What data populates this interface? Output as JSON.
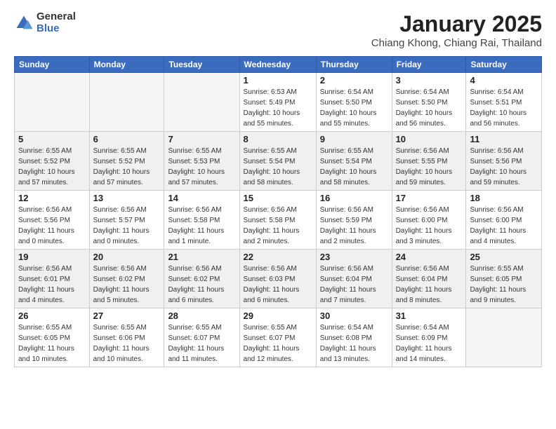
{
  "logo": {
    "general": "General",
    "blue": "Blue"
  },
  "title": "January 2025",
  "subtitle": "Chiang Khong, Chiang Rai, Thailand",
  "days_of_week": [
    "Sunday",
    "Monday",
    "Tuesday",
    "Wednesday",
    "Thursday",
    "Friday",
    "Saturday"
  ],
  "weeks": [
    [
      {
        "day": "",
        "info": ""
      },
      {
        "day": "",
        "info": ""
      },
      {
        "day": "",
        "info": ""
      },
      {
        "day": "1",
        "info": "Sunrise: 6:53 AM\nSunset: 5:49 PM\nDaylight: 10 hours\nand 55 minutes."
      },
      {
        "day": "2",
        "info": "Sunrise: 6:54 AM\nSunset: 5:50 PM\nDaylight: 10 hours\nand 55 minutes."
      },
      {
        "day": "3",
        "info": "Sunrise: 6:54 AM\nSunset: 5:50 PM\nDaylight: 10 hours\nand 56 minutes."
      },
      {
        "day": "4",
        "info": "Sunrise: 6:54 AM\nSunset: 5:51 PM\nDaylight: 10 hours\nand 56 minutes."
      }
    ],
    [
      {
        "day": "5",
        "info": "Sunrise: 6:55 AM\nSunset: 5:52 PM\nDaylight: 10 hours\nand 57 minutes."
      },
      {
        "day": "6",
        "info": "Sunrise: 6:55 AM\nSunset: 5:52 PM\nDaylight: 10 hours\nand 57 minutes."
      },
      {
        "day": "7",
        "info": "Sunrise: 6:55 AM\nSunset: 5:53 PM\nDaylight: 10 hours\nand 57 minutes."
      },
      {
        "day": "8",
        "info": "Sunrise: 6:55 AM\nSunset: 5:54 PM\nDaylight: 10 hours\nand 58 minutes."
      },
      {
        "day": "9",
        "info": "Sunrise: 6:55 AM\nSunset: 5:54 PM\nDaylight: 10 hours\nand 58 minutes."
      },
      {
        "day": "10",
        "info": "Sunrise: 6:56 AM\nSunset: 5:55 PM\nDaylight: 10 hours\nand 59 minutes."
      },
      {
        "day": "11",
        "info": "Sunrise: 6:56 AM\nSunset: 5:56 PM\nDaylight: 10 hours\nand 59 minutes."
      }
    ],
    [
      {
        "day": "12",
        "info": "Sunrise: 6:56 AM\nSunset: 5:56 PM\nDaylight: 11 hours\nand 0 minutes."
      },
      {
        "day": "13",
        "info": "Sunrise: 6:56 AM\nSunset: 5:57 PM\nDaylight: 11 hours\nand 0 minutes."
      },
      {
        "day": "14",
        "info": "Sunrise: 6:56 AM\nSunset: 5:58 PM\nDaylight: 11 hours\nand 1 minute."
      },
      {
        "day": "15",
        "info": "Sunrise: 6:56 AM\nSunset: 5:58 PM\nDaylight: 11 hours\nand 2 minutes."
      },
      {
        "day": "16",
        "info": "Sunrise: 6:56 AM\nSunset: 5:59 PM\nDaylight: 11 hours\nand 2 minutes."
      },
      {
        "day": "17",
        "info": "Sunrise: 6:56 AM\nSunset: 6:00 PM\nDaylight: 11 hours\nand 3 minutes."
      },
      {
        "day": "18",
        "info": "Sunrise: 6:56 AM\nSunset: 6:00 PM\nDaylight: 11 hours\nand 4 minutes."
      }
    ],
    [
      {
        "day": "19",
        "info": "Sunrise: 6:56 AM\nSunset: 6:01 PM\nDaylight: 11 hours\nand 4 minutes."
      },
      {
        "day": "20",
        "info": "Sunrise: 6:56 AM\nSunset: 6:02 PM\nDaylight: 11 hours\nand 5 minutes."
      },
      {
        "day": "21",
        "info": "Sunrise: 6:56 AM\nSunset: 6:02 PM\nDaylight: 11 hours\nand 6 minutes."
      },
      {
        "day": "22",
        "info": "Sunrise: 6:56 AM\nSunset: 6:03 PM\nDaylight: 11 hours\nand 6 minutes."
      },
      {
        "day": "23",
        "info": "Sunrise: 6:56 AM\nSunset: 6:04 PM\nDaylight: 11 hours\nand 7 minutes."
      },
      {
        "day": "24",
        "info": "Sunrise: 6:56 AM\nSunset: 6:04 PM\nDaylight: 11 hours\nand 8 minutes."
      },
      {
        "day": "25",
        "info": "Sunrise: 6:55 AM\nSunset: 6:05 PM\nDaylight: 11 hours\nand 9 minutes."
      }
    ],
    [
      {
        "day": "26",
        "info": "Sunrise: 6:55 AM\nSunset: 6:05 PM\nDaylight: 11 hours\nand 10 minutes."
      },
      {
        "day": "27",
        "info": "Sunrise: 6:55 AM\nSunset: 6:06 PM\nDaylight: 11 hours\nand 10 minutes."
      },
      {
        "day": "28",
        "info": "Sunrise: 6:55 AM\nSunset: 6:07 PM\nDaylight: 11 hours\nand 11 minutes."
      },
      {
        "day": "29",
        "info": "Sunrise: 6:55 AM\nSunset: 6:07 PM\nDaylight: 11 hours\nand 12 minutes."
      },
      {
        "day": "30",
        "info": "Sunrise: 6:54 AM\nSunset: 6:08 PM\nDaylight: 11 hours\nand 13 minutes."
      },
      {
        "day": "31",
        "info": "Sunrise: 6:54 AM\nSunset: 6:09 PM\nDaylight: 11 hours\nand 14 minutes."
      },
      {
        "day": "",
        "info": ""
      }
    ]
  ]
}
